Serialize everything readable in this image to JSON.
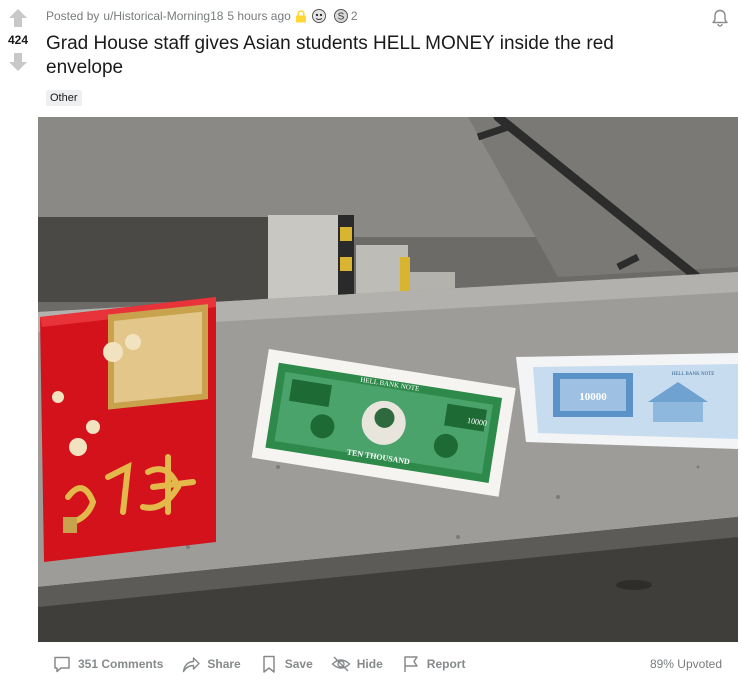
{
  "post": {
    "score": "424",
    "posted_by_prefix": "Posted by",
    "author": "u/Historical-Morning18",
    "time_ago": "5 hours ago",
    "award_count": "2",
    "title": "Grad House staff gives Asian students HELL MONEY inside the red envelope",
    "flair": "Other",
    "upvote_ratio": "89% Upvoted"
  },
  "image_text": {
    "note_header": "HELL BANK NOTE",
    "note_denomination": "TEN THOUSAND",
    "note_corner": "10000",
    "blue_note_header": "HELL BANK NOTE",
    "blue_note_value": "10000"
  },
  "actions": {
    "comments": "351 Comments",
    "share": "Share",
    "save": "Save",
    "hide": "Hide",
    "report": "Report"
  },
  "icons": {
    "upvote": "upvote-arrow-icon",
    "downvote": "downvote-arrow-icon",
    "lock": "lock-icon",
    "bell": "bell-icon",
    "comment": "comment-icon",
    "share": "share-icon",
    "save": "bookmark-icon",
    "hide": "eye-slash-icon",
    "report": "flag-icon"
  },
  "colors": {
    "vote_arrow": "#c8c8c8",
    "lock": "#ffd635",
    "meta_text": "#787c7e",
    "action_text": "#878a8c"
  }
}
